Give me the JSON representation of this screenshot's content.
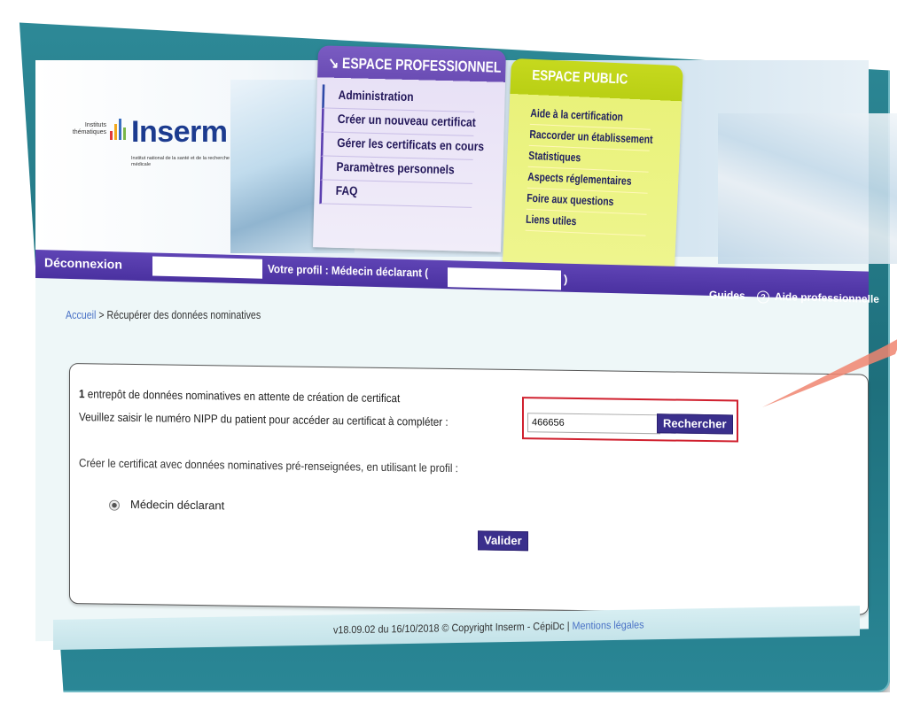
{
  "logo": {
    "instituts": "Instituts thématiques",
    "name": "Inserm",
    "subtitle": "Institut national de la santé et de la recherche médicale"
  },
  "pro_space": {
    "title": "ESPACE PROFESSIONNEL",
    "items": [
      {
        "label": "Administration"
      },
      {
        "label": "Créer un nouveau certificat"
      },
      {
        "label": "Gérer les certificats en cours"
      },
      {
        "label": "Paramètres personnels"
      },
      {
        "label": "FAQ"
      }
    ]
  },
  "public_space": {
    "title": "ESPACE PUBLIC",
    "items": [
      {
        "label": "Aide à la certification"
      },
      {
        "label": "Raccorder un établissement"
      },
      {
        "label": "Statistiques"
      },
      {
        "label": "Aspects réglementaires"
      },
      {
        "label": "Foire aux questions"
      },
      {
        "label": "Liens utiles"
      }
    ]
  },
  "bar": {
    "logout_label": "Déconnexion",
    "profile_label": "Votre profil : Médecin déclarant (",
    "profile_close": ")",
    "guides_label": "Guides",
    "help_label": "Aide professionnelle"
  },
  "breadcrumb": {
    "home": "Accueil",
    "separator": " > ",
    "current": "Récupérer des données nominatives"
  },
  "panel": {
    "count": "1",
    "line1": " entrepôt de données nominatives en attente de création de certificat",
    "line2": "Veuillez saisir le numéro NIPP du patient pour accéder au certificat à compléter :",
    "nipp_value": "466656",
    "search_label": "Rechercher",
    "line3": "Créer le certificat avec données nominatives pré-renseignées, en utilisant le profil :",
    "radio_label": "Médecin déclarant",
    "validate_label": "Valider"
  },
  "footer": {
    "version": "v18.09.02 du 16/10/2018 © Copyright Inserm - CépiDc | ",
    "legal_label": "Mentions légales"
  },
  "colors": {
    "pro_purple": "#6a4cb4",
    "public_yellow": "#c6d91e",
    "highlight_red": "#d0202e",
    "frame_teal": "#1e6f7c"
  }
}
